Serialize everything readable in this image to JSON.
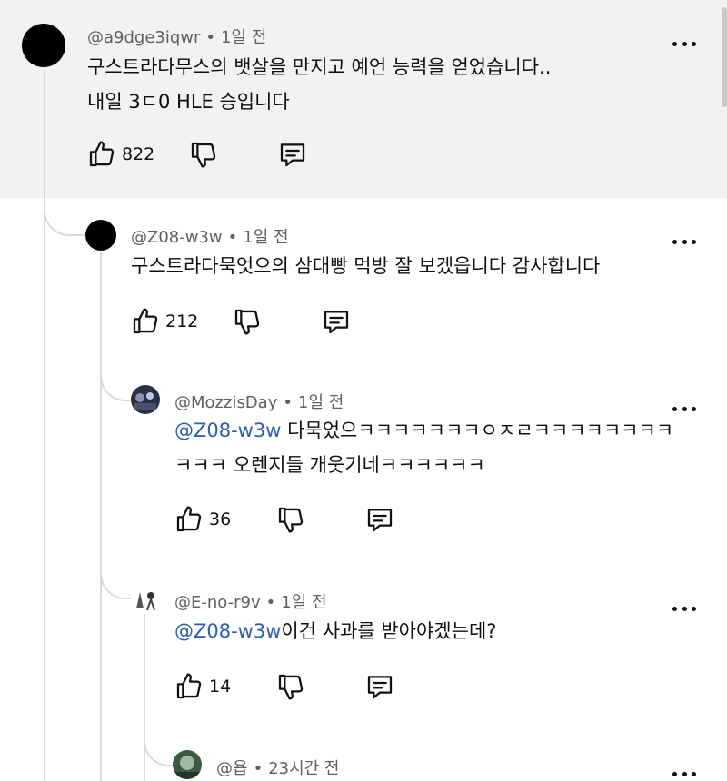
{
  "comments": [
    {
      "author": "@a9dge3iqwr",
      "time": "1일 전",
      "line1": "구스트라다무스의 뱃살을 만지고 예언 능력을 얻었습니다..",
      "line2": "내일 3ㄷ0 HLE 승입니다",
      "likes": "822",
      "avatar_color": "#000000"
    },
    {
      "author": "@Z08-w3w",
      "time": "1일 전",
      "line1": "구스트라다묵엇으의 삼대빵 먹방 잘 보겠읍니다 감사합니다",
      "likes": "212",
      "avatar_color": "#000000"
    },
    {
      "author": "@MozzisDay",
      "time": "1일 전",
      "mention": "@Z08-w3w",
      "line1": " 다묵었으ㅋㅋㅋㅋㅋㅋㅋㅇㅈㄹㅋㅋㅋㅋㅋㅋㅋㅋ",
      "line2": "ㅋㅋㅋ 오렌지들 개웃기네ㅋㅋㅋㅋㅋㅋ",
      "likes": "36"
    },
    {
      "author": "@E-no-r9v",
      "time": "1일 전",
      "mention": "@Z08-w3w",
      "line1": "이건 사과를 받아야겠는데?",
      "likes": "14"
    },
    {
      "author": "@욥",
      "time": "23시간 전"
    }
  ],
  "colors": {
    "mention": "#2b5fae",
    "meta": "#606060",
    "highlight_bg": "#f2f2f2"
  },
  "icons": [
    "like-icon",
    "dislike-icon",
    "reply-icon",
    "more-options-icon"
  ]
}
